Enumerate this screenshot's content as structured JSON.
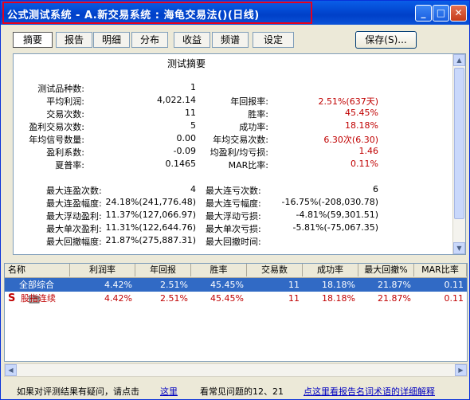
{
  "window": {
    "title": "公式测试系统 - A.新交易系统 : 海龟交易法()(日线)"
  },
  "tabs": [
    {
      "label": "摘要",
      "active": true
    },
    {
      "label": "报告"
    },
    {
      "label": "明细"
    },
    {
      "label": "分布"
    },
    {
      "label": "收益"
    },
    {
      "label": "频谱"
    },
    {
      "label": "设定"
    }
  ],
  "save_button": "保存(S)...",
  "summary": {
    "title": "测试摘要",
    "left_labels": [
      "测试品种数:",
      "平均利润:",
      "交易次数:",
      "盈利交易次数:",
      "年均信号数量:",
      "盈利系数:",
      "夏普率:"
    ],
    "left_values": [
      "1",
      "4,022.14",
      "11",
      "5",
      "0.00",
      "-0.09",
      "0.1465"
    ],
    "right_labels": [
      "年回报率:",
      "胜率:",
      "成功率:",
      "年均交易次数:",
      "均盈利/均亏损:",
      "MAR比率:"
    ],
    "right_values": [
      "2.51%(637天)",
      "45.45%",
      "18.18%",
      "6.30次(6.30)",
      "1.46",
      "0.11%"
    ],
    "left2_labels": [
      "最大连盈次数:",
      "最大连盈幅度:",
      "最大浮动盈利:",
      "最大单次盈利:",
      "最大回撤幅度:"
    ],
    "left2_values": [
      "4",
      "24.18%(241,776.48)",
      "11.37%(127,066.97)",
      "11.31%(122,644.76)",
      "21.87%(275,887.31)"
    ],
    "right2_labels": [
      "最大连亏次数:",
      "最大连亏幅度:",
      "最大浮动亏损:",
      "最大单次亏损:",
      "最大回撤时间:"
    ],
    "right2_values": [
      "6",
      "-16.75%(-208,030.78)",
      "-4.81%(59,301.51)",
      "-5.81%(-75,067.35)",
      ""
    ]
  },
  "grid": {
    "headers": [
      "名称",
      "利润率",
      "年回报",
      "胜率",
      "交易数",
      "成功率",
      "最大回撤%",
      "MAR比率"
    ],
    "rows": [
      {
        "icon": "folder-icon",
        "cells": [
          "全部综合",
          "4.42%",
          "2.51%",
          "45.45%",
          "11",
          "18.18%",
          "21.87%",
          "0.11"
        ]
      },
      {
        "icon": "S",
        "cells": [
          "股指连续",
          "4.42%",
          "2.51%",
          "45.45%",
          "11",
          "18.18%",
          "21.87%",
          "0.11"
        ]
      }
    ]
  },
  "footer": {
    "question_text": "如果对评测结果有疑问，请点击",
    "question_link": "这里",
    "faq_text": "看常见问题的12、21",
    "glossary_link": "点这里看报告名词术语的详细解释"
  },
  "colors": {
    "titlebar": "#0247d0",
    "highlight": "#e8001c",
    "selection": "#316ac5",
    "red": "#c00000"
  }
}
